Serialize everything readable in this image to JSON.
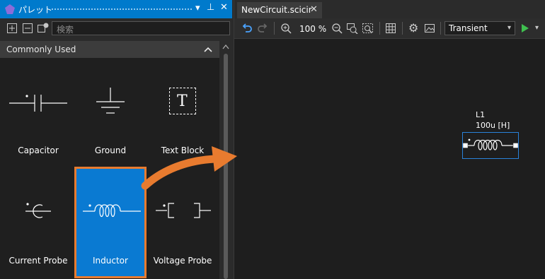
{
  "palette": {
    "title": "パレット",
    "search_placeholder": "検索",
    "section_label": "Commonly Used",
    "items": [
      {
        "label": "Capacitor"
      },
      {
        "label": "Ground"
      },
      {
        "label": "Text Block"
      },
      {
        "label": "Current Probe"
      },
      {
        "label": "Inductor"
      },
      {
        "label": "Voltage Probe"
      }
    ],
    "text_block_glyph": "T"
  },
  "editor": {
    "tab_label": "NewCircuit.scicir",
    "zoom": "100 %",
    "analysis": "Transient",
    "component": {
      "name": "L1",
      "value": "100u [H]"
    }
  },
  "colors": {
    "accent": "#007acc",
    "highlight": "#e87b2f",
    "selected": "#0a7ad2"
  }
}
